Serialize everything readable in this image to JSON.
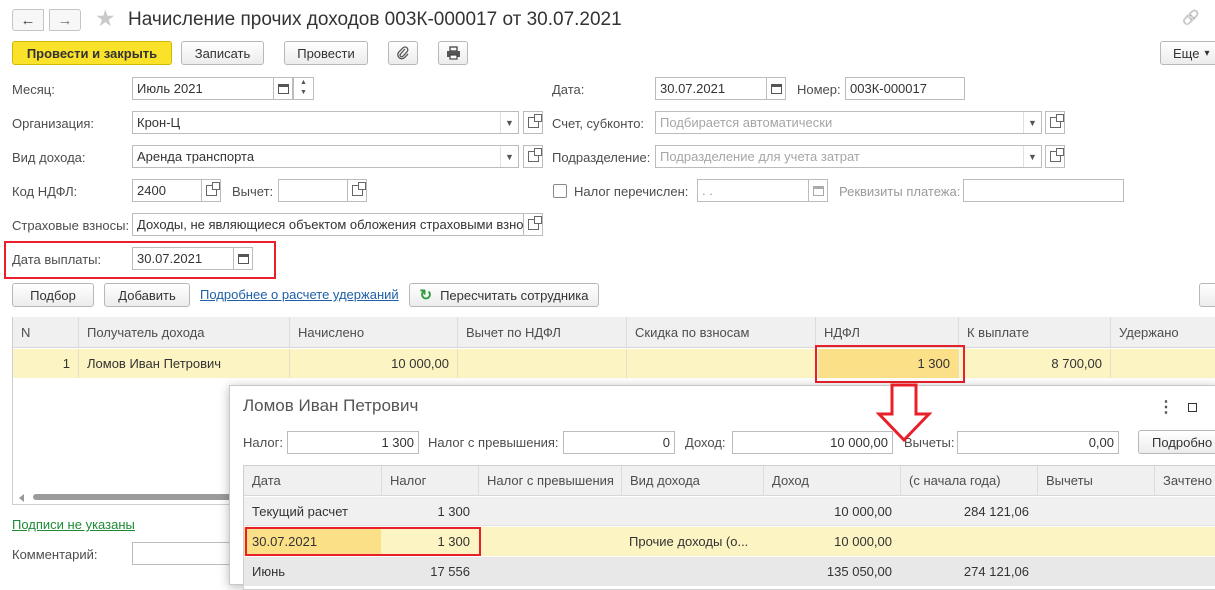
{
  "window": {
    "title": "Начисление прочих доходов 003К-000017 от 30.07.2021",
    "nav_back": "←",
    "nav_forward": "→",
    "star": "★",
    "link_icon": "🔗"
  },
  "toolbar": {
    "post_close": "Провести и закрыть",
    "save": "Записать",
    "post": "Провести",
    "more": "Еще",
    "more_arrow": "▾"
  },
  "form": {
    "month_label": "Месяц:",
    "month_value": "Июль 2021",
    "date_label": "Дата:",
    "date_value": "30.07.2021",
    "number_label": "Номер:",
    "number_value": "003К-000017",
    "org_label": "Организация:",
    "org_value": "Крон-Ц",
    "account_label": "Счет, субконто:",
    "account_placeholder": "Подбирается автоматически",
    "income_type_label": "Вид дохода:",
    "income_type_value": "Аренда транспорта",
    "subdivision_label": "Подразделение:",
    "subdivision_placeholder": "Подразделение для учета затрат",
    "ndfl_code_label": "Код НДФЛ:",
    "ndfl_code_value": "2400",
    "deduction_label": "Вычет:",
    "deduction_value": "",
    "tax_paid_label": "Налог перечислен:",
    "tax_paid_date": " .  .",
    "payment_details_label": "Реквизиты платежа:",
    "payment_details_value": "",
    "insurance_label": "Страховые взносы:",
    "insurance_value": "Доходы, не являющиеся объектом обложения страховыми взно",
    "pay_date_label": "Дата выплаты:",
    "pay_date_value": "30.07.2021"
  },
  "actions": {
    "select": "Подбор",
    "add": "Добавить",
    "details_link": "Подробнее о расчете удержаний",
    "recalc": "Пересчитать сотрудника",
    "recalc_icon": "↻"
  },
  "grid": {
    "headers": [
      "N",
      "Получатель дохода",
      "Начислено",
      "Вычет по НДФЛ",
      "Скидка по взносам",
      "НДФЛ",
      "К выплате",
      "Удержано"
    ],
    "row": {
      "n": "1",
      "recipient": "Ломов Иван Петрович",
      "accrued": "10 000,00",
      "deduction": "",
      "discount": "",
      "ndfl": "1 300",
      "to_pay": "8 700,00",
      "withheld": ""
    }
  },
  "footer": {
    "signatures_link": "Подписи не указаны",
    "comment_label": "Комментарий:"
  },
  "popup": {
    "title": "Ломов Иван Петрович",
    "menu_icon": "⋮",
    "maximize_icon": "□",
    "tax_label": "Налог:",
    "tax_value": "1 300",
    "excess_label": "Налог с превышения:",
    "excess_value": "0",
    "income_label": "Доход:",
    "income_value": "10 000,00",
    "deductions_label": "Вычеты:",
    "deductions_value": "0,00",
    "details_button": "Подробно",
    "headers": [
      "Дата",
      "Налог",
      "Налог с превышения",
      "Вид дохода",
      "Доход",
      "(с начала года)",
      "Вычеты",
      "Зачтено"
    ],
    "rows": [
      {
        "date": "Текущий расчет",
        "tax": "1 300",
        "excess": "",
        "kind": "",
        "income": "10 000,00",
        "ytd": "284 121,06",
        "deductions": "",
        "credited": ""
      },
      {
        "date": "30.07.2021",
        "tax": "1 300",
        "excess": "",
        "kind": "Прочие доходы (о...",
        "income": "10 000,00",
        "ytd": "",
        "deductions": "",
        "credited": ""
      },
      {
        "date": "Июнь",
        "tax": "17 556",
        "excess": "",
        "kind": "",
        "income": "135 050,00",
        "ytd": "274 121,06",
        "deductions": "",
        "credited": ""
      }
    ]
  },
  "colors": {
    "accent_yellow": "#fbe22a",
    "highlight_row": "#fdf4c3",
    "selected_cell": "#fbe088",
    "red_frame": "#e8202a",
    "link_blue": "#1f5fa8",
    "link_green": "#1e8a36"
  }
}
